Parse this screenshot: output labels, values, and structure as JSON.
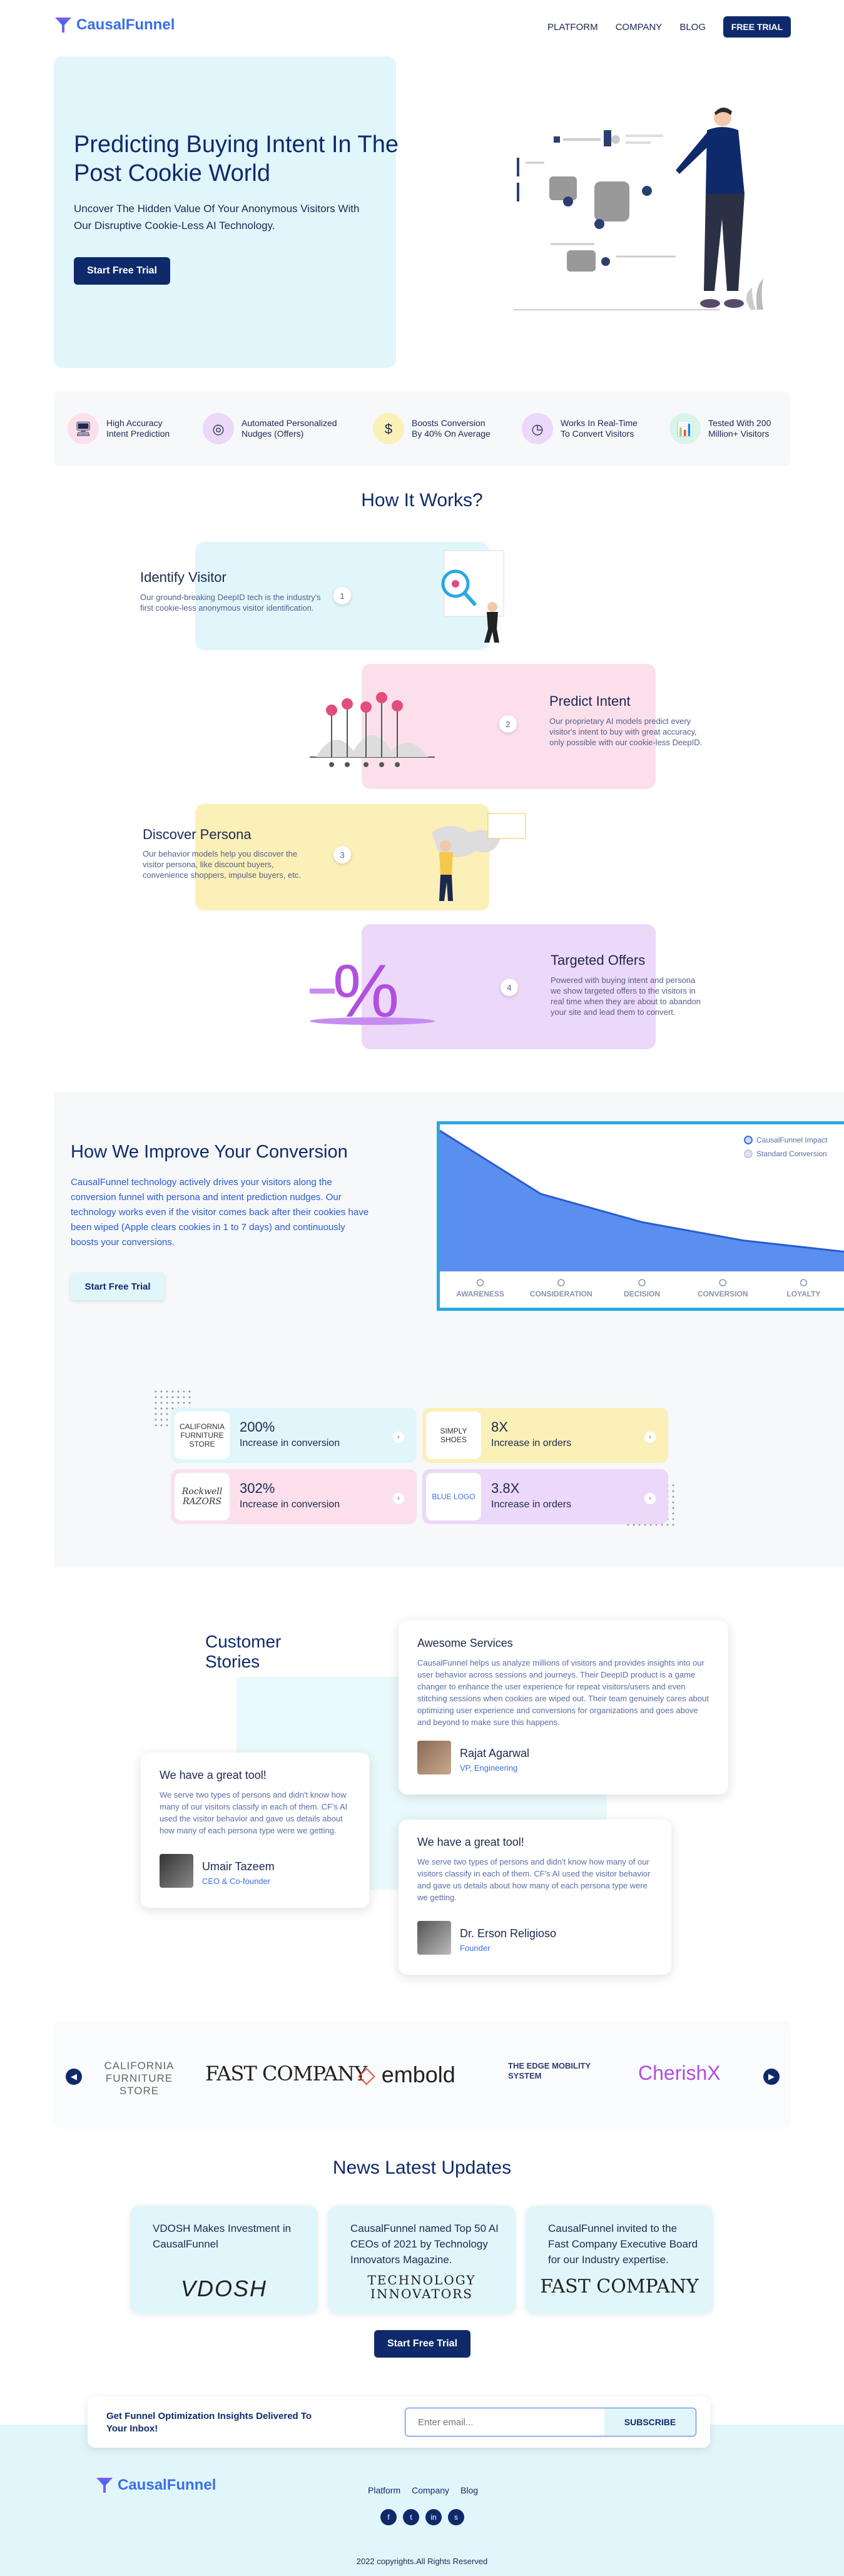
{
  "brand": {
    "name": "CausalFunnel",
    "accent": "#3a6ee8",
    "dark": "#0f2a6b",
    "light_blue": "#e1f6fb"
  },
  "nav": {
    "items": [
      "PLATFORM",
      "COMPANY",
      "BLOG"
    ],
    "cta": "FREE TRIAL"
  },
  "hero": {
    "title": "Predicting Buying Intent In The Post Cookie World",
    "subtitle": "Uncover The Hidden Value Of Your Anonymous Visitors With Our Disruptive Cookie-Less AI Technology.",
    "cta": "Start Free Trial"
  },
  "features": [
    {
      "icon": "monitor-icon",
      "label": "High Accuracy Intent Prediction"
    },
    {
      "icon": "target-icon",
      "label": "Automated Personalized Nudges (Offers)"
    },
    {
      "icon": "coins-icon",
      "label": "Boosts Conversion By 40% On Average"
    },
    {
      "icon": "clock-icon",
      "label": "Works In Real-Time To Convert Visitors"
    },
    {
      "icon": "chart-icon",
      "label": "Tested With 200 Million+ Visitors"
    }
  ],
  "how": {
    "title": "How It Works?",
    "steps": [
      {
        "num": "1",
        "title": "Identify Visitor",
        "text": "Our ground-breaking DeepID tech is the industry's first cookie-less anonymous visitor identification."
      },
      {
        "num": "2",
        "title": "Predict Intent",
        "text": "Our proprietary AI models predict every visitor's intent to buy with great accuracy, only possible with our cookie-less DeepID."
      },
      {
        "num": "3",
        "title": "Discover Persona",
        "text": "Our behavior models help you discover the visitor persona, like discount buyers, convenience shoppers, impulse buyers, etc."
      },
      {
        "num": "4",
        "title": "Targeted Offers",
        "text": "Powered with buying intent and persona we show targeted offers to the visitors in real time when they are about to abandon your site and lead them to convert."
      }
    ]
  },
  "improve": {
    "title": "How We Improve Your Conversion",
    "text": "CausalFunnel technology actively drives your visitors along the conversion funnel with persona and intent prediction nudges. Our technology works even if the visitor comes back after their cookies have been wiped (Apple clears cookies in 1 to 7 days) and continuously boosts your conversions.",
    "cta": "Start Free Trial"
  },
  "chart_data": {
    "type": "area",
    "categories": [
      "AWARENESS",
      "CONSIDERATION",
      "DECISION",
      "CONVERSION",
      "LOYALTY"
    ],
    "series": [
      {
        "name": "CausalFunnel Impact",
        "values": [
          100,
          55,
          35,
          22,
          14
        ],
        "color": "#5a8fef"
      },
      {
        "name": "Standard Conversion",
        "values": [
          100,
          45,
          25,
          14,
          8
        ],
        "color": "#dde3ee"
      }
    ],
    "legend": "top-right",
    "grid": false
  },
  "cases": [
    {
      "logo": "CALIFORNIA FURNITURE STORE",
      "value": "200%",
      "label": "Increase in conversion",
      "color": "#e1f6fb"
    },
    {
      "logo": "SIMPLY SHOES",
      "value": "8X",
      "label": "Increase in orders",
      "color": "#fbf0b8"
    },
    {
      "logo": "Rockwell RAZORS",
      "value": "302%",
      "label": "Increase in conversion",
      "color": "#fbe0ec"
    },
    {
      "logo": "BLUE LOGO",
      "value": "3.8X",
      "label": "Increase in orders",
      "color": "#ecd8f8"
    }
  ],
  "stories": {
    "title": "Customer Stories",
    "items": [
      {
        "title": "Awesome Services",
        "text": "CausalFunnel helps us analyze millions of visitors and provides insights into our user behavior across sessions and journeys. Their DeepID product is a game changer to enhance the user experience for repeat visitors/users and even stitching sessions when cookies are wiped out. Their team genuinely cares about optimizing user experience and conversions for organizations and goes above and beyond to make sure this happens.",
        "name": "Rajat Agarwal",
        "role": "VP, Engineering"
      },
      {
        "title": "We have a great tool!",
        "text": "We serve two types of persons and didn't know how many of our visitors classify in each of them. CF's AI used the visitor behavior and gave us details about how many of each persona type were we getting.",
        "name": "Umair Tazeem",
        "role": "CEO & Co-founder"
      },
      {
        "title": "We have a great tool!",
        "text": "We serve two types of persons and didn't know how many of our visitors classify in each of them. CF's AI used the visitor behavior and gave us details about how many of each persona type were we getting.",
        "name": "Dr. Erson Religioso",
        "role": "Founder"
      }
    ]
  },
  "brands": [
    "CALIFORNIA FURNITURE STORE",
    "FAST COMPANY",
    "embold",
    "THE EDGE MOBILITY SYSTEM",
    "CherishX"
  ],
  "news": {
    "title": "News Latest Updates",
    "items": [
      {
        "text": "VDOSH Makes Investment in CausalFunnel",
        "logo": "VDOSH"
      },
      {
        "text": "CausalFunnel named Top 50 AI CEOs of 2021 by Technology Innovators Magazine.",
        "logo": "TECHNOLOGY INNOVATORS"
      },
      {
        "text": "CausalFunnel invited to the Fast Company Executive Board for our Industry expertise.",
        "logo": "FAST COMPANY"
      }
    ],
    "cta": "Start Free Trial"
  },
  "subscribe": {
    "text": "Get Funnel Optimization Insights Delivered To Your Inbox!",
    "placeholder": "Enter email...",
    "button": "SUBSCRIBE"
  },
  "footer": {
    "links": [
      "Platform",
      "Company",
      "Blog"
    ],
    "social": [
      "f",
      "t",
      "in",
      "s"
    ],
    "copyright": "2022 copyrights.All Rights Reserved"
  }
}
